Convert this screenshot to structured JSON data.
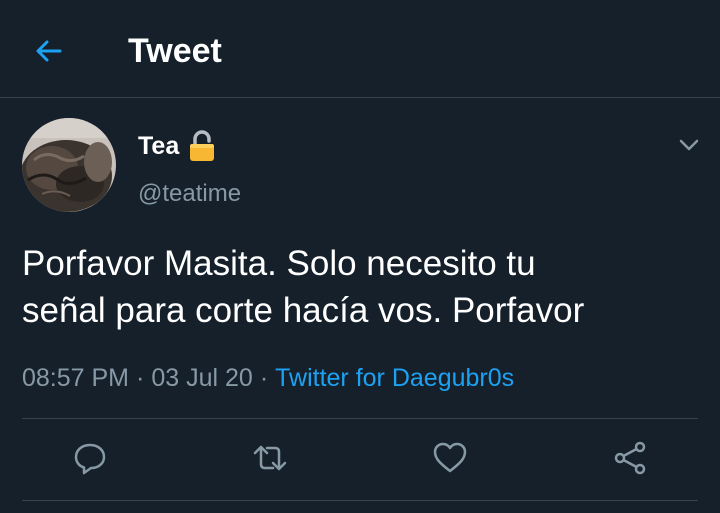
{
  "header": {
    "title": "Tweet",
    "back_icon": "arrow-left-icon",
    "accent_color": "#1da1f2"
  },
  "tweet": {
    "author": {
      "display_name": "Tea",
      "handle": "@teatime",
      "protected_icon": "lock-icon"
    },
    "text": "Porfavor Masita. Solo necesito tu\nseñal para corte hacía vos. Porfavor",
    "time": "08:57 PM",
    "date": "03 Jul 20",
    "separator": "·",
    "source": "Twitter for Daegubr0s"
  },
  "actions": [
    {
      "icon": "reply-icon"
    },
    {
      "icon": "retweet-icon"
    },
    {
      "icon": "like-icon"
    },
    {
      "icon": "share-icon"
    }
  ],
  "colors": {
    "background": "#15202b",
    "border": "#38444d",
    "secondary_text": "#8899a6",
    "primary_text": "#ffffff"
  }
}
